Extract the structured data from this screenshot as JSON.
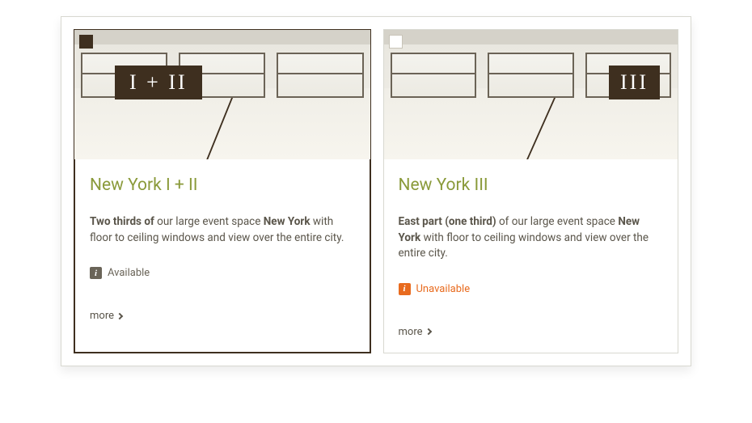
{
  "cards": [
    {
      "title": "New York I + II",
      "room_label": "I + II",
      "selected": true,
      "desc_bold1": "Two thirds of",
      "desc_mid": " our large event space ",
      "desc_bold2": "New York",
      "desc_end": " with floor to ceiling windows and view over the entire city.",
      "status_type": "available",
      "status_text": "Available",
      "more_label": "more"
    },
    {
      "title": "New York III",
      "room_label": "III",
      "selected": false,
      "desc_bold1": "East part (one third)",
      "desc_mid": " of our large event space ",
      "desc_bold2": "New York",
      "desc_end": " with floor to ceiling windows and view over the entire city.",
      "status_type": "unavailable",
      "status_text": "Unavailable",
      "more_label": "more"
    }
  ]
}
